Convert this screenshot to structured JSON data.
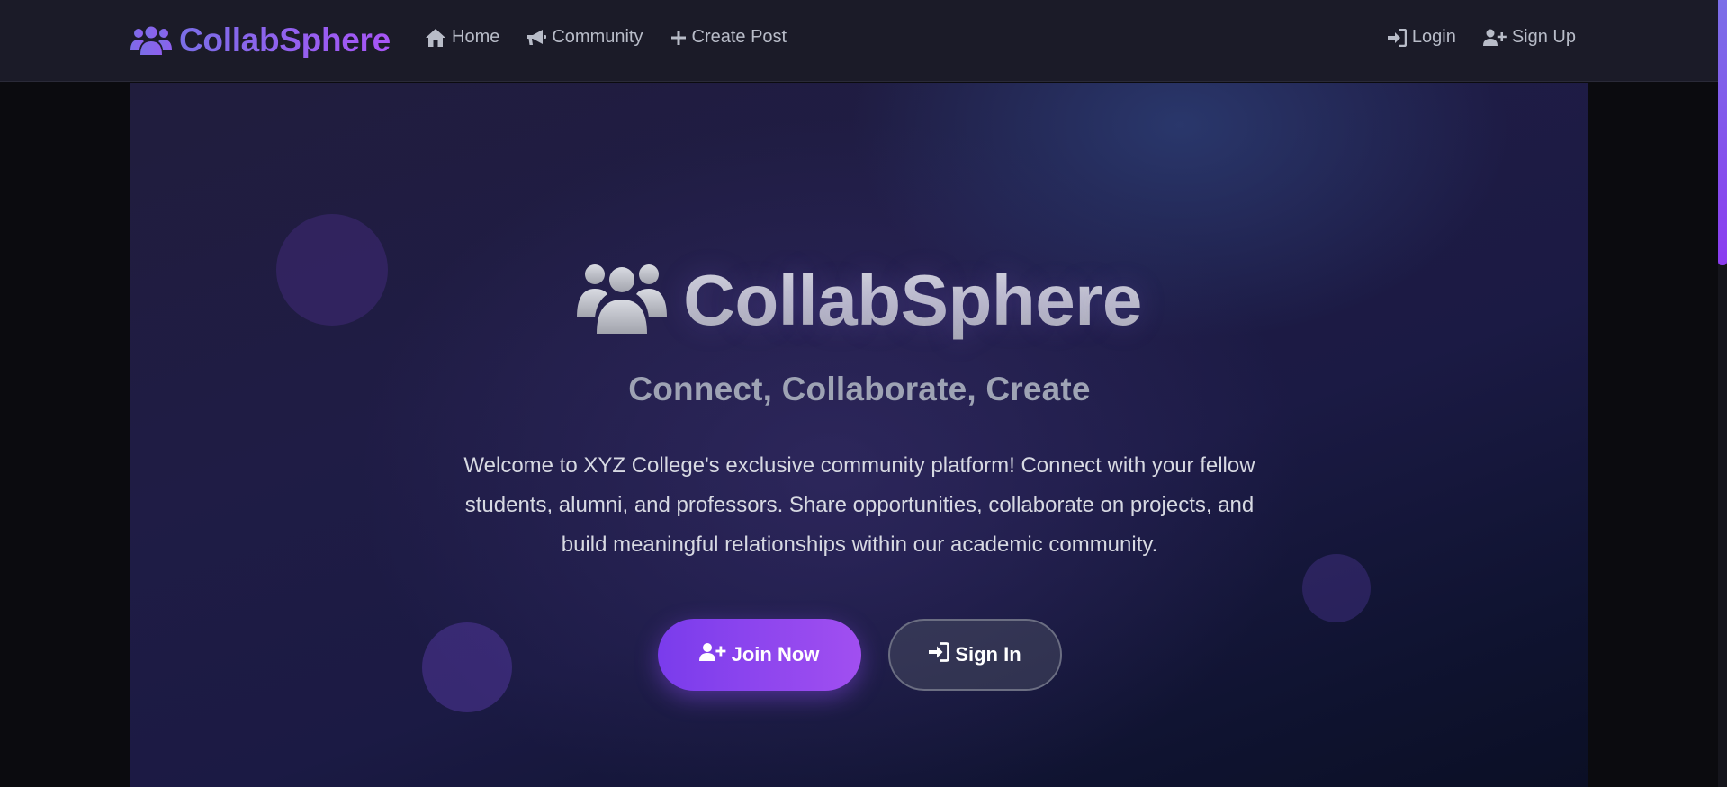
{
  "navbar": {
    "brand": "CollabSphere",
    "links": [
      {
        "label": "Home",
        "icon": "home-icon"
      },
      {
        "label": "Community",
        "icon": "megaphone-icon"
      },
      {
        "label": "Create Post",
        "icon": "plus-icon"
      }
    ],
    "auth": [
      {
        "label": "Login",
        "icon": "sign-in-icon"
      },
      {
        "label": "Sign Up",
        "icon": "user-plus-icon"
      }
    ]
  },
  "hero": {
    "title": "CollabSphere",
    "subtitle": "Connect, Collaborate, Create",
    "description": "Welcome to XYZ College's exclusive community platform! Connect with your fellow students, alumni, and professors. Share opportunities, collaborate on projects, and build meaningful relationships within our academic community.",
    "primary_button": "Join Now",
    "secondary_button": "Sign In"
  },
  "colors": {
    "accent": "#8b5cf6",
    "navbar_bg": "#1b1b28",
    "page_bg": "#0b0b0f",
    "nav_text": "#b8bcc8"
  }
}
